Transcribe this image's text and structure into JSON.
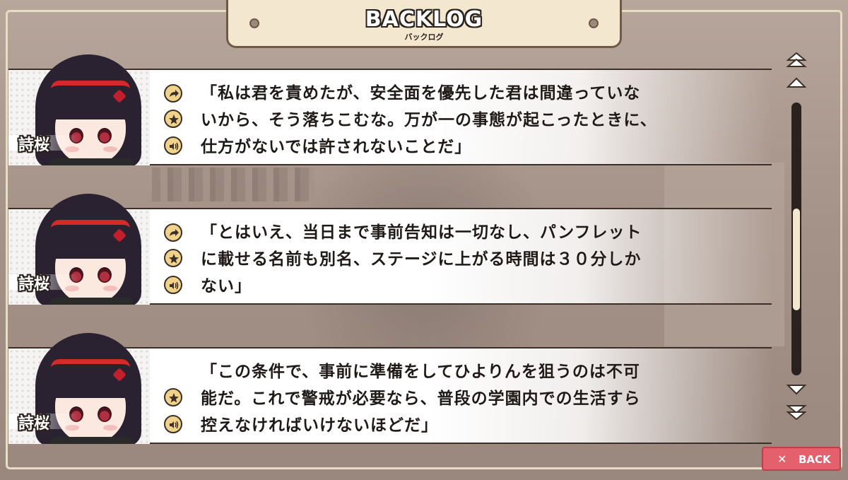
{
  "header": {
    "title": "BACKLOG",
    "subtitle": "バックログ"
  },
  "entries": [
    {
      "speaker": "詩桜",
      "lines": [
        "「私は君を責めたが、安全面を優先した君は間違っていな",
        "いから、そう落ちこむな。万が一の事態が起こったときに、",
        "仕方がないでは許されないことだ」"
      ],
      "buttons": [
        "jump-icon",
        "favorite-star-icon",
        "voice-replay-icon"
      ]
    },
    {
      "speaker": "詩桜",
      "lines": [
        "「とはいえ、当日まで事前告知は一切なし、パンフレット",
        "に載せる名前も別名、ステージに上がる時間は３０分しか",
        "ない」"
      ],
      "buttons": [
        "jump-icon",
        "favorite-star-icon",
        "voice-replay-icon"
      ]
    },
    {
      "speaker": "詩桜",
      "lines": [
        "「この条件で、事前に準備をしてひよりんを狙うのは不可",
        "能だ。これで警戒が必要なら、普段の学園内での生活すら",
        "控えなければいけないほどだ」"
      ],
      "buttons": [
        "favorite-star-icon",
        "voice-replay-icon"
      ]
    }
  ],
  "scrollbar": {
    "buttons": [
      "scroll-top-icon",
      "scroll-up-icon",
      "scroll-down-icon",
      "scroll-bottom-icon"
    ],
    "position_fraction": 0.62
  },
  "back_button": {
    "icon": "close-icon",
    "label": "BACK"
  },
  "colors": {
    "accent_gold": "#f0d28a",
    "back_red": "#e4606c",
    "frame_cream": "#f3e8cf"
  }
}
